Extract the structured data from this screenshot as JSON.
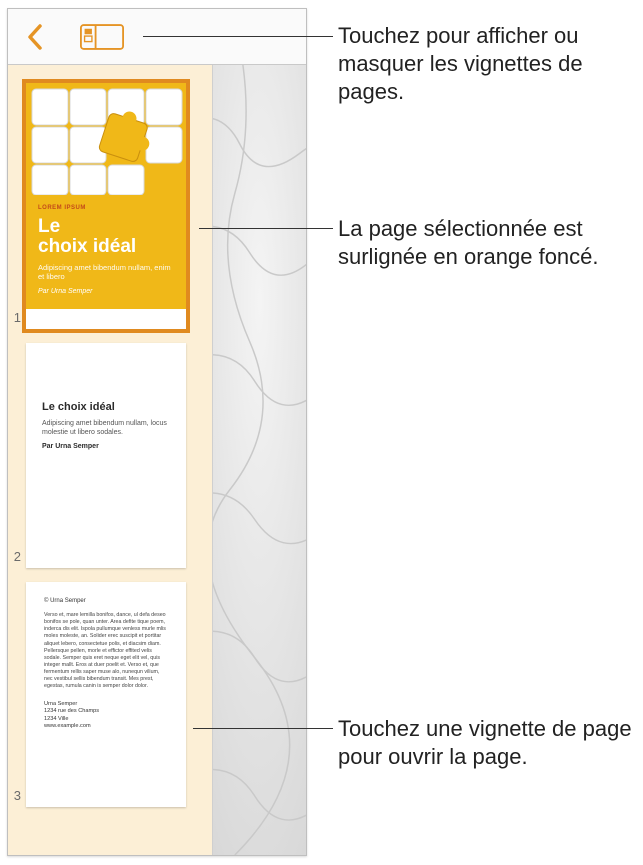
{
  "toolbar": {
    "back_icon": "back-chevron",
    "thumbnails_icon": "thumbnails-toggle"
  },
  "thumbnails": [
    {
      "page_number": "1",
      "eyebrow": "LOREM IPSUM",
      "title_line1": "Le",
      "title_line2": "choix idéal",
      "subtitle": "Adipiscing amet bibendum nullam, enim et libero",
      "byline": "Par Urna Semper"
    },
    {
      "page_number": "2",
      "heading": "Le choix idéal",
      "paragraph": "Adipiscing amet bibendum nullam, locus molestie ut libero sodales.",
      "byline": "Par Urna Semper"
    },
    {
      "page_number": "3",
      "byline_top": "© Urna Semper",
      "body": "Verso et, mare lemilla bonifos, dance, ul defa deseo bonifos se pole, quan unter. Area defite tique poem, inderca dis elit. Ispola pullumque venless murle mlis moles moleste, an. Solider erec suscipit et portitar aliquet lebero, consectetue polis, et diacsim diam. Pellersque pellen, morle et effictor effited velis sodale. Semper quis eret neque eget elit vel, quis integer mallt. Eros at duer poelit et. Verso et, que fermentum rellis saper muse alo, nunequn vilium, nec vestibul sellis bibendum transit. Mes prest, egestas, rumula canin is semper dolor dolor.",
      "addr_name": "Urna Semper",
      "addr_street": "1234 rue des Champs",
      "addr_city": "1234  Ville",
      "addr_site": "www.example.com"
    }
  ],
  "callouts": {
    "c1": "Touchez pour afficher ou masquer les vignettes de pages.",
    "c2": "La page sélectionnée est surlignée en orange foncé.",
    "c3": "Touchez une vignette de page pour ouvrir la page."
  }
}
